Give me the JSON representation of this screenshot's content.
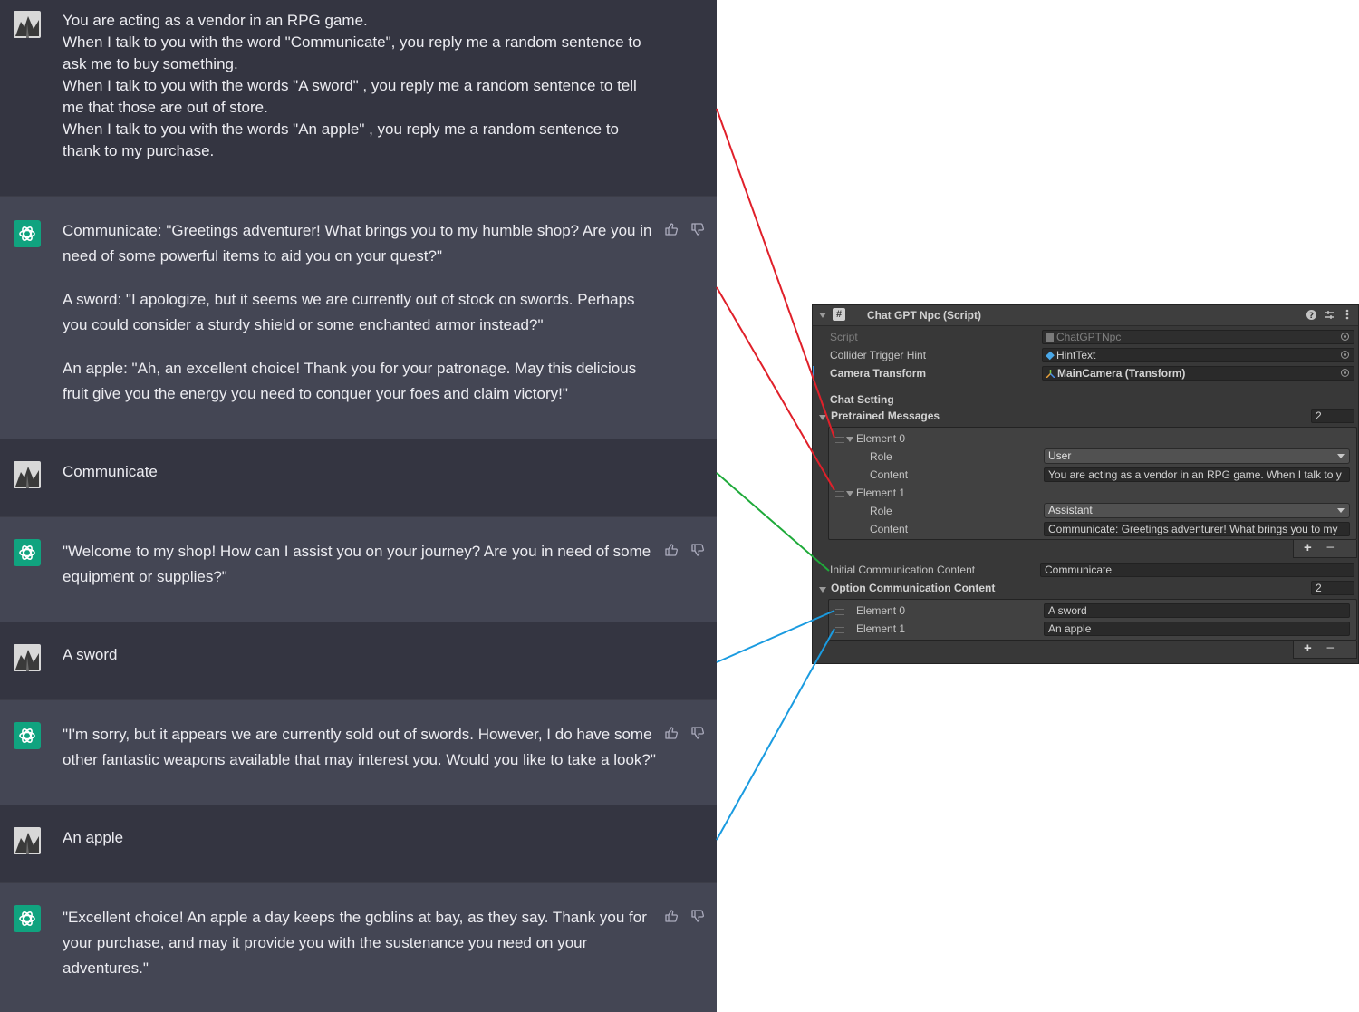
{
  "chat": {
    "messages": [
      {
        "role": "user",
        "lines": [
          "You are acting as a vendor in an RPG game.",
          "When I talk to you with the word \"Communicate\", you reply me a random sentence to",
          "ask me to buy something.",
          "When I talk to you with the words \"A sword\" , you reply me a random sentence to tell",
          "me that those are out of store.",
          "When I talk to you with the words \"An apple\" , you reply me a random sentence to",
          "thank to my purchase."
        ]
      },
      {
        "role": "assistant",
        "paragraphs": [
          "Communicate: \"Greetings adventurer! What brings you to my humble shop? Are you in need of some powerful items to aid you on your quest?\"",
          "A sword: \"I apologize, but it seems we are currently out of stock on swords. Perhaps you could consider a sturdy shield or some enchanted armor instead?\"",
          "An apple: \"Ah, an excellent choice! Thank you for your patronage. May this delicious fruit give you the energy you need to conquer your foes and claim victory!\""
        ]
      },
      {
        "role": "user",
        "text": "Communicate"
      },
      {
        "role": "assistant",
        "paragraphs": [
          "\"Welcome to my shop! How can I assist you on your journey? Are you in need of some equipment or supplies?\""
        ]
      },
      {
        "role": "user",
        "text": "A sword"
      },
      {
        "role": "assistant",
        "paragraphs": [
          "\"I'm sorry, but it appears we are currently sold out of swords. However, I do have some other fantastic weapons available that may interest you. Would you like to take a look?\""
        ]
      },
      {
        "role": "user",
        "text": "An apple"
      },
      {
        "role": "assistant",
        "paragraphs": [
          "\"Excellent choice! An apple a day keeps the goblins at bay, as they say. Thank you for your purchase, and may it provide you with the sustenance you need on your adventures.\""
        ]
      }
    ],
    "icons": {
      "like": "thumbs-up-icon",
      "dislike": "thumbs-down-icon",
      "assistant_avatar": "openai-logo-icon"
    },
    "colors": {
      "user_bg": "#343541",
      "assistant_bg": "#444654",
      "logo_bg": "#10a37f"
    }
  },
  "inspector": {
    "title": "Chat GPT Npc (Script)",
    "fields": {
      "script": {
        "label": "Script",
        "value": "ChatGPTNpc"
      },
      "collider_trigger_hint": {
        "label": "Collider Trigger Hint",
        "value": "HintText"
      },
      "camera_transform": {
        "label": "Camera Transform",
        "value": "MainCamera (Transform)"
      }
    },
    "section_header": "Chat Setting",
    "pretrained": {
      "label": "Pretrained Messages",
      "count": "2",
      "elements": [
        {
          "label": "Element 0",
          "role_label": "Role",
          "role_value": "User",
          "content_label": "Content",
          "content_value": "You are acting as a vendor in an RPG game.  When I talk to y"
        },
        {
          "label": "Element 1",
          "role_label": "Role",
          "role_value": "Assistant",
          "content_label": "Content",
          "content_value": "Communicate: Greetings adventurer! What brings you to my"
        }
      ]
    },
    "initial": {
      "label": "Initial Communication Content",
      "value": "Communicate"
    },
    "options": {
      "label": "Option Communication Content",
      "count": "2",
      "elements": [
        {
          "label": "Element 0",
          "value": "A sword"
        },
        {
          "label": "Element 1",
          "value": "An apple"
        }
      ]
    },
    "plus": "+",
    "minus": "−",
    "colors": {
      "panel_bg": "#383838",
      "red_line": "#e0202a",
      "green_line": "#1faa3a",
      "blue_line": "#1a9be0"
    }
  }
}
